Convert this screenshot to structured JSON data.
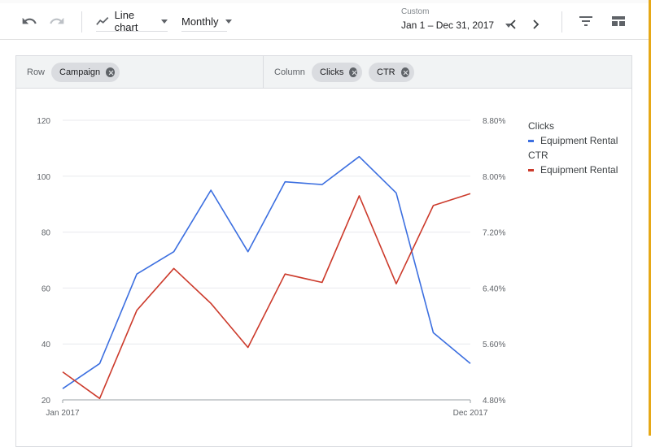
{
  "toolbar": {
    "undo_icon": "undo-icon",
    "redo_icon": "redo-icon",
    "chart_type_icon": "line-chart-icon",
    "chart_type_label": "Line chart",
    "granularity_label": "Monthly",
    "date_range": {
      "label": "Custom",
      "value": "Jan 1 – Dec 31, 2017"
    },
    "filter_icon": "filter-icon",
    "layout_icon": "table-layout-icon"
  },
  "pivot": {
    "row_label": "Row",
    "row_chips": [
      "Campaign"
    ],
    "column_label": "Column",
    "column_chips": [
      "Clicks",
      "CTR"
    ]
  },
  "colors": {
    "clicks": "#3c6fe0",
    "ctr": "#cc3a2b",
    "accent_border": "#e6a817"
  },
  "chart_data": {
    "type": "line",
    "x": [
      "Jan 2017",
      "Feb 2017",
      "Mar 2017",
      "Apr 2017",
      "May 2017",
      "Jun 2017",
      "Jul 2017",
      "Aug 2017",
      "Sep 2017",
      "Oct 2017",
      "Nov 2017",
      "Dec 2017"
    ],
    "x_tick_labels": [
      "Jan 2017",
      "Dec 2017"
    ],
    "left_axis": {
      "ylim": [
        20,
        120
      ],
      "ticks": [
        "20",
        "40",
        "60",
        "80",
        "100",
        "120"
      ]
    },
    "right_axis": {
      "ylim": [
        4.8,
        8.8
      ],
      "ticks": [
        "4.80%",
        "5.60%",
        "6.40%",
        "7.20%",
        "8.00%",
        "8.80%"
      ]
    },
    "series": [
      {
        "name": "Equipment Rental",
        "group": "Clicks",
        "axis": "left",
        "color": "#3c6fe0",
        "values": [
          24,
          33,
          65,
          73,
          95,
          73,
          98,
          97,
          107,
          94,
          44,
          33
        ]
      },
      {
        "name": "Equipment Rental",
        "group": "CTR",
        "axis": "right",
        "color": "#cc3a2b",
        "values": [
          5.2,
          4.82,
          6.08,
          6.68,
          6.18,
          5.55,
          6.6,
          6.48,
          7.72,
          6.46,
          7.58,
          7.75
        ]
      }
    ],
    "grid": true,
    "legend_position": "right"
  },
  "legend": {
    "groups": [
      {
        "title": "Clicks",
        "items": [
          {
            "label": "Equipment Rental",
            "color": "#3c6fe0"
          }
        ]
      },
      {
        "title": "CTR",
        "items": [
          {
            "label": "Equipment Rental",
            "color": "#cc3a2b"
          }
        ]
      }
    ]
  }
}
